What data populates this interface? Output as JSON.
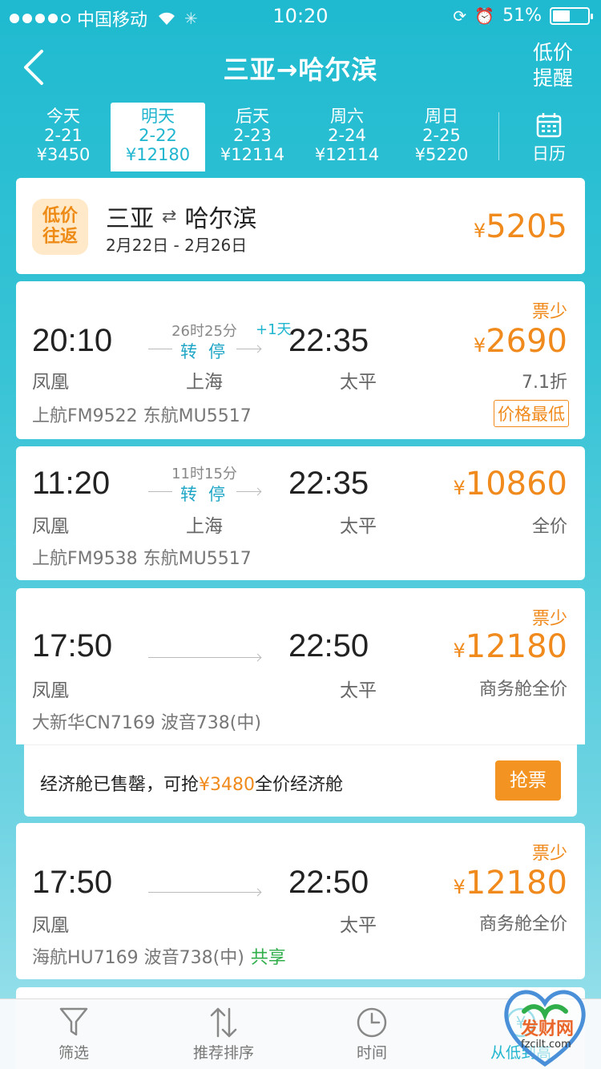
{
  "status_bar": {
    "carrier": "中国移动",
    "time": "10:20",
    "battery": "51%",
    "battery_level": 0.51
  },
  "header": {
    "title": "三亚→哈尔滨",
    "alert_line1": "低价",
    "alert_line2": "提醒"
  },
  "date_tabs": [
    {
      "day": "今天",
      "date": "2-21",
      "price": "¥3450"
    },
    {
      "day": "明天",
      "date": "2-22",
      "price": "¥12180"
    },
    {
      "day": "后天",
      "date": "2-23",
      "price": "¥12114"
    },
    {
      "day": "周六",
      "date": "2-24",
      "price": "¥12114"
    },
    {
      "day": "周日",
      "date": "2-25",
      "price": "¥5220"
    }
  ],
  "calendar_label": "日历",
  "round_trip": {
    "badge_line1": "低价",
    "badge_line2": "往返",
    "from": "三亚",
    "to": "哈尔滨",
    "dates": "2月22日 - 2月26日",
    "currency": "¥",
    "price": "5205"
  },
  "flights": [
    {
      "dep_time": "20:10",
      "arr_time": "22:35",
      "dep_city": "凤凰",
      "arr_city": "太平",
      "via_city": "上海",
      "duration": "26时25分",
      "plus_day": "+1天",
      "transfer": "转停",
      "airlines": "上航FM9522  东航MU5517",
      "tag": "票少",
      "currency": "¥",
      "price": "2690",
      "discount": "7.1折",
      "badge": "价格最低"
    },
    {
      "dep_time": "11:20",
      "arr_time": "22:35",
      "dep_city": "凤凰",
      "arr_city": "太平",
      "via_city": "上海",
      "duration": "11时15分",
      "transfer": "转停",
      "airlines": "上航FM9538  东航MU5517",
      "currency": "¥",
      "price": "10860",
      "discount": "全价"
    },
    {
      "dep_time": "17:50",
      "arr_time": "22:50",
      "dep_city": "凤凰",
      "arr_city": "太平",
      "airlines": "大新华CN7169  波音738(中)",
      "tag": "票少",
      "currency": "¥",
      "price": "12180",
      "discount": "商务舱全价"
    },
    {
      "dep_time": "17:50",
      "arr_time": "22:50",
      "dep_city": "凤凰",
      "arr_city": "太平",
      "airlines": "海航HU7169  波音738(中)",
      "share": "共享",
      "tag": "票少",
      "currency": "¥",
      "price": "12180",
      "discount": "商务舱全价"
    }
  ],
  "soldout": {
    "text_before": "经济舱已售罄，可抢",
    "price": "¥3480",
    "text_after": "全价经济舱",
    "button": "抢票"
  },
  "tabbar": [
    {
      "label": "筛选",
      "icon": "filter-icon"
    },
    {
      "label": "推荐排序",
      "icon": "sort-icon"
    },
    {
      "label": "时间",
      "icon": "clock-icon"
    },
    {
      "label": "从低到高",
      "icon": "price-sort-icon"
    }
  ],
  "watermark": {
    "text": "发财网",
    "url": "fzcilt.com"
  },
  "colors": {
    "primary": "#1fbad0",
    "accent": "#f08a1c",
    "share_green": "#2fae4a"
  }
}
